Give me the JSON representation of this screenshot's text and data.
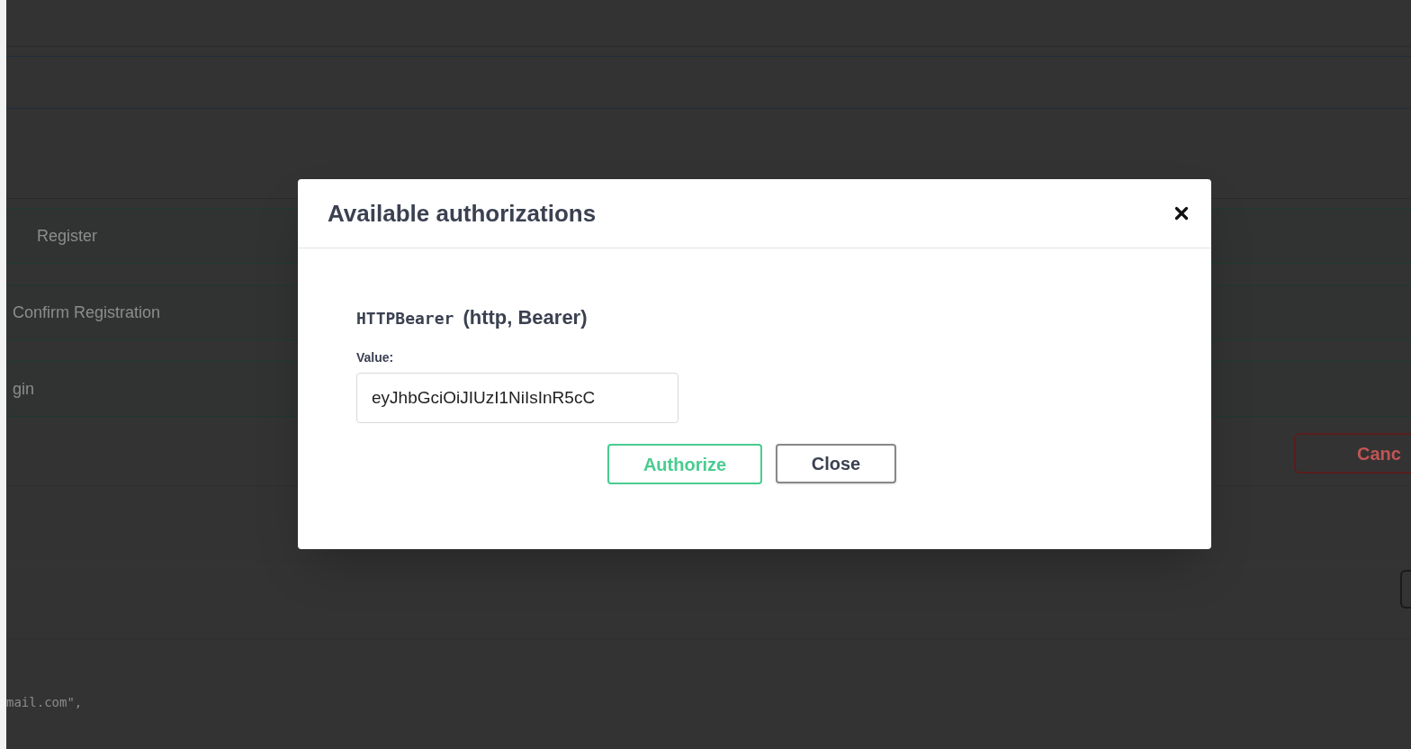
{
  "background": {
    "operations": [
      {
        "summary": "Register"
      },
      {
        "summary": "Confirm Registration"
      },
      {
        "summary": "gin"
      }
    ],
    "cancel_button": "Canc",
    "code_line": "mail.com\","
  },
  "dialog": {
    "title": "Available authorizations",
    "scheme": {
      "name": "HTTPBearer",
      "type": "(http, Bearer)"
    },
    "value_label": "Value:",
    "value": "eyJhbGciOiJIUzI1NiIsInR5cC",
    "buttons": [
      {
        "label": "Authorize",
        "kind": "primary"
      },
      {
        "label": "Close",
        "kind": "secondary"
      }
    ]
  }
}
